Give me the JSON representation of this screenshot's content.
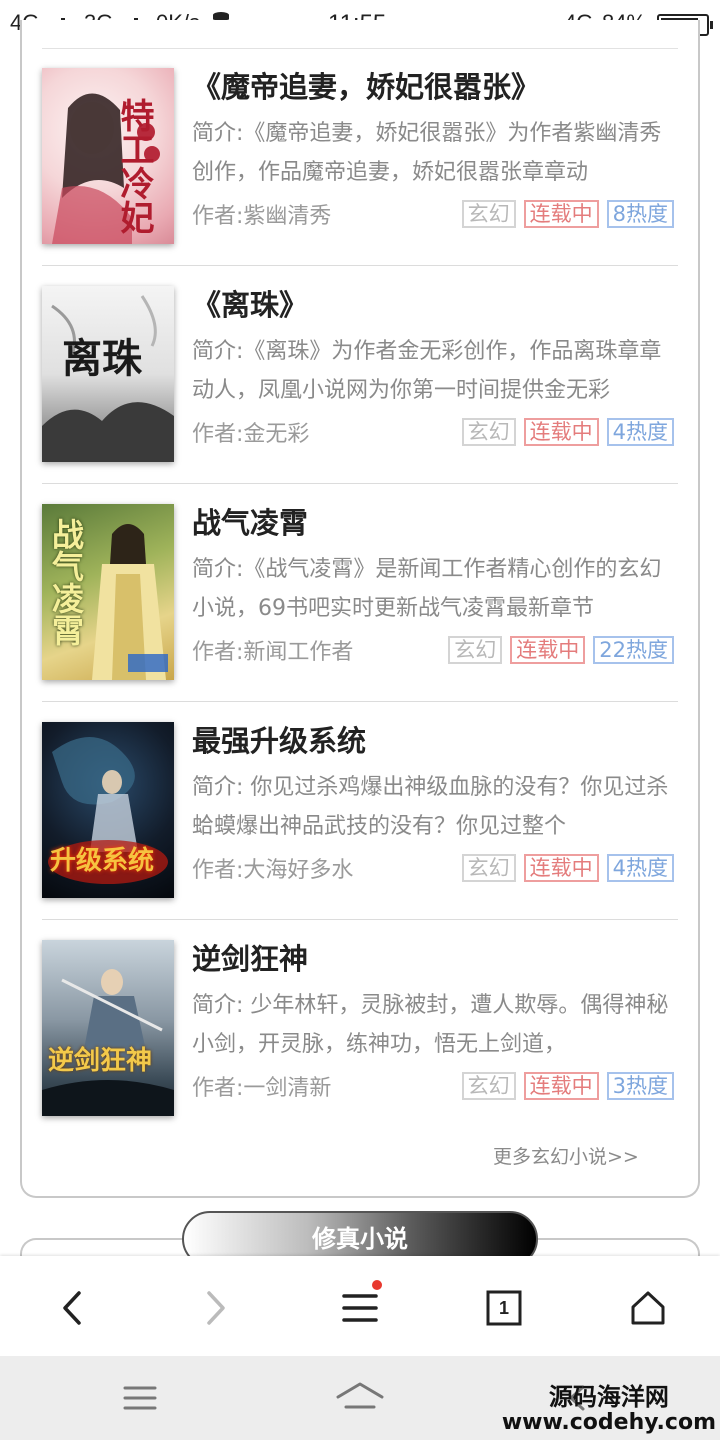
{
  "status_bar": {
    "network1": "4G",
    "network2": "3G",
    "speed": "0K/s",
    "time": "11:55",
    "network3": "4G",
    "battery": "84%",
    "battery_level": 0.84
  },
  "books": [
    {
      "title": "《魔帝追妻，娇妃很嚣张》",
      "desc": "简介:《魔帝追妻，娇妃很嚣张》为作者紫幽清秀创作，作品魔帝追妻，娇妃很嚣张章章动",
      "author": "作者:紫幽清秀",
      "genre": "玄幻",
      "status": "连载中",
      "hot": "8热度",
      "cover_text": "特工冷妃"
    },
    {
      "title": "《离珠》",
      "desc": "简介:《离珠》为作者金无彩创作，作品离珠章章动人，凤凰小说网为你第一时间提供金无彩",
      "author": "作者:金无彩",
      "genre": "玄幻",
      "status": "连载中",
      "hot": "4热度",
      "cover_text": "离珠"
    },
    {
      "title": "战气凌霄",
      "desc": "简介:《战气凌霄》是新闻工作者精心创作的玄幻小说，69书吧实时更新战气凌霄最新章节",
      "author": "作者:新闻工作者",
      "genre": "玄幻",
      "status": "连载中",
      "hot": "22热度",
      "cover_text": "战气凌霄"
    },
    {
      "title": "最强升级系统",
      "desc": "简介: 你见过杀鸡爆出神级血脉的没有？你见过杀蛤蟆爆出神品武技的没有？你见过整个",
      "author": "作者:大海好多水",
      "genre": "玄幻",
      "status": "连载中",
      "hot": "4热度",
      "cover_text": "升级系统"
    },
    {
      "title": "逆剑狂神",
      "desc": "简介: 少年林轩，灵脉被封，遭人欺辱。偶得神秘小剑，开灵脉，练神功，悟无上剑道，",
      "author": "作者:一剑清新",
      "genre": "玄幻",
      "status": "连载中",
      "hot": "3热度",
      "cover_text": "逆剑狂神"
    }
  ],
  "more_link": "更多玄幻小说>>",
  "next_section": "修真小说",
  "browser_bar": {
    "tab_count": "1",
    "icons": [
      "back-arrow-icon",
      "forward-arrow-icon",
      "menu-icon",
      "tabs-icon",
      "home-icon"
    ],
    "accent": "#e8392f"
  },
  "watermark": {
    "line1": "源码海洋网",
    "line2": "www.codehy.com"
  }
}
